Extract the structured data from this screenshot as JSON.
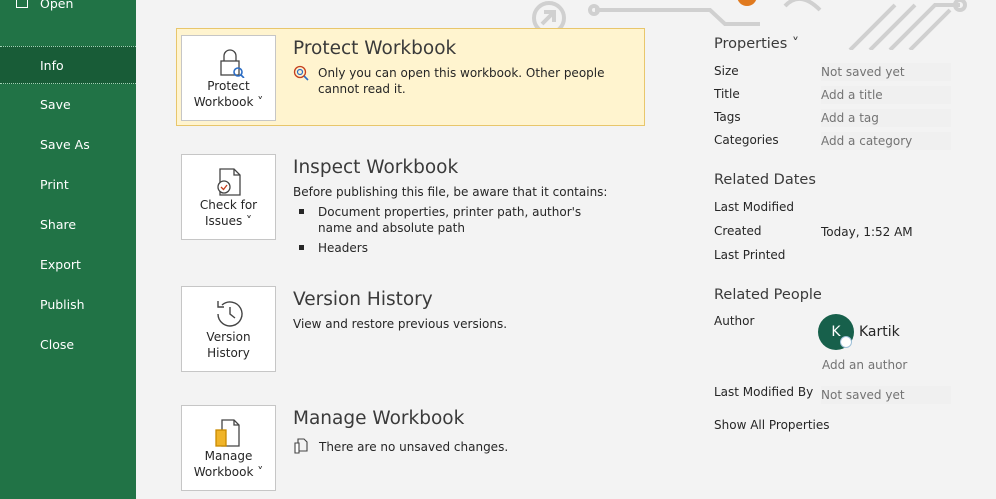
{
  "sidebar": {
    "open_label": "Open",
    "items": [
      {
        "label": "Info"
      },
      {
        "label": "Save"
      },
      {
        "label": "Save As"
      },
      {
        "label": "Print"
      },
      {
        "label": "Share"
      },
      {
        "label": "Export"
      },
      {
        "label": "Publish"
      },
      {
        "label": "Close"
      }
    ]
  },
  "protect": {
    "button_label": "Protect\nWorkbook ˅",
    "title": "Protect Workbook",
    "text": "Only you can open this workbook. Other people cannot read it."
  },
  "inspect": {
    "button_label": "Check for\nIssues ˅",
    "title": "Inspect Workbook",
    "intro": "Before publishing this file, be aware that it contains:",
    "bullets": [
      "Document properties, printer path, author's name and absolute path",
      "Headers"
    ]
  },
  "version": {
    "button_label": "Version\nHistory",
    "title": "Version History",
    "text": "View and restore previous versions."
  },
  "manage": {
    "button_label": "Manage\nWorkbook ˅",
    "title": "Manage Workbook",
    "text": "There are no unsaved changes."
  },
  "properties": {
    "header": "Properties ˅",
    "size_label": "Size",
    "size_value": "Not saved yet",
    "title_label": "Title",
    "title_placeholder": "Add a title",
    "tags_label": "Tags",
    "tags_placeholder": "Add a tag",
    "categories_label": "Categories",
    "categories_placeholder": "Add a category"
  },
  "related_dates": {
    "header": "Related Dates",
    "last_modified_label": "Last Modified",
    "created_label": "Created",
    "created_value": "Today, 1:52 AM",
    "last_printed_label": "Last Printed"
  },
  "related_people": {
    "header": "Related People",
    "author_label": "Author",
    "author_initial": "K",
    "author_name": "Kartik",
    "add_author": "Add an author",
    "last_modified_by_label": "Last Modified By",
    "last_modified_by_value": "Not saved yet",
    "show_all": "Show All Properties"
  },
  "colors": {
    "sidebar": "#217346",
    "sidebar_selected": "#185c37",
    "protect_highlight": "#fff4cf",
    "link": "#2b579a",
    "avatar": "#17604b"
  }
}
